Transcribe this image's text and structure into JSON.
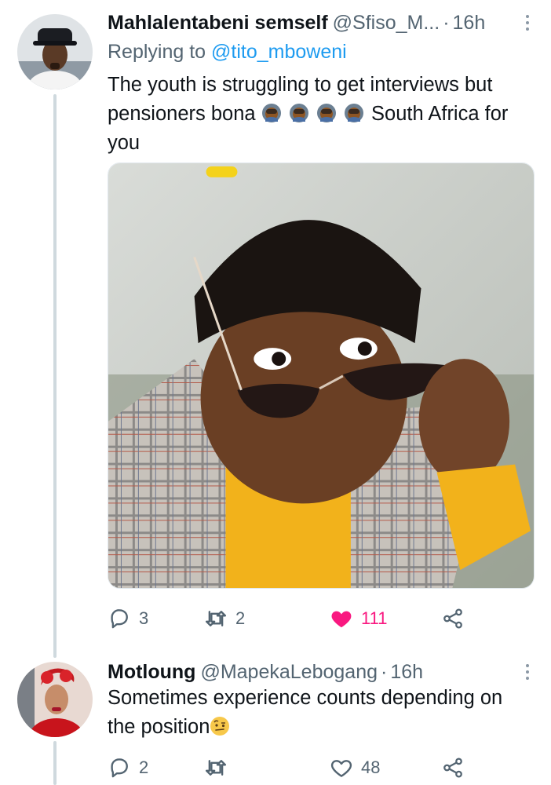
{
  "tweets": [
    {
      "display_name": "Mahlalentabeni semself",
      "handle": "@Sfiso_M...",
      "separator": "·",
      "time": "16h",
      "replying_prefix": "Replying to",
      "replying_to": "@tito_mboweni",
      "text_part1": "The youth is struggling to get interviews but pensioners bona",
      "emoji": "facepalm-emoji x4",
      "text_part2": "South Africa for you",
      "media": "photo of child in plaid blazer and yellow top peering over sunglasses",
      "actions": {
        "replies": "3",
        "retweets": "2",
        "likes": "111",
        "liked": true
      },
      "colors": {
        "like_active": "#f91880"
      }
    },
    {
      "display_name": "Motloung",
      "handle": "@MapekaLebogang",
      "separator": "·",
      "time": "16h",
      "text": "Sometimes experience counts depending on the position",
      "emoji": "face-with-raised-eyebrow-emoji",
      "actions": {
        "replies": "2",
        "retweets": "",
        "likes": "48",
        "liked": false
      }
    }
  ],
  "theme": {
    "accent": "#1d9bf0",
    "secondary_text": "#536471",
    "thread_line": "#cfd9de"
  }
}
